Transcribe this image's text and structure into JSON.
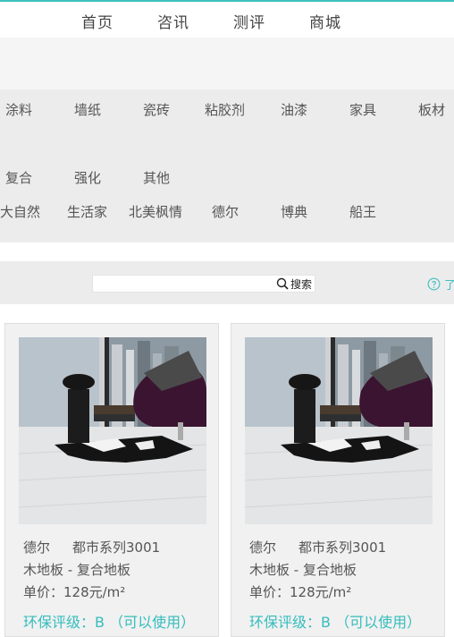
{
  "nav": {
    "items": [
      "首页",
      "咨讯",
      "测评",
      "商城"
    ]
  },
  "filters": {
    "materials": [
      "涂料",
      "墙纸",
      "瓷砖",
      "粘胶剂",
      "油漆",
      "家具",
      "板材"
    ],
    "floor_types": [
      "复合",
      "强化",
      "其他"
    ],
    "brands": [
      "大自然",
      "生活家",
      "北美枫情",
      "德尔",
      "博典",
      "船王"
    ]
  },
  "search": {
    "value": "",
    "button_label": "搜索",
    "help_text": "了"
  },
  "products": [
    {
      "brand": "德尔",
      "series": "都市系列3001",
      "category": "木地板 -  复合地板",
      "price": "单价：128元/m²",
      "eco_rating": "环保评级：B  （可以使用）"
    },
    {
      "brand": "德尔",
      "series": "都市系列3001",
      "category": "木地板 -  复合地板",
      "price": "单价：128元/m²",
      "eco_rating": "环保评级：B  （可以使用）"
    }
  ],
  "colors": {
    "accent": "#3fbfbf",
    "filter_bg": "#ececec"
  }
}
